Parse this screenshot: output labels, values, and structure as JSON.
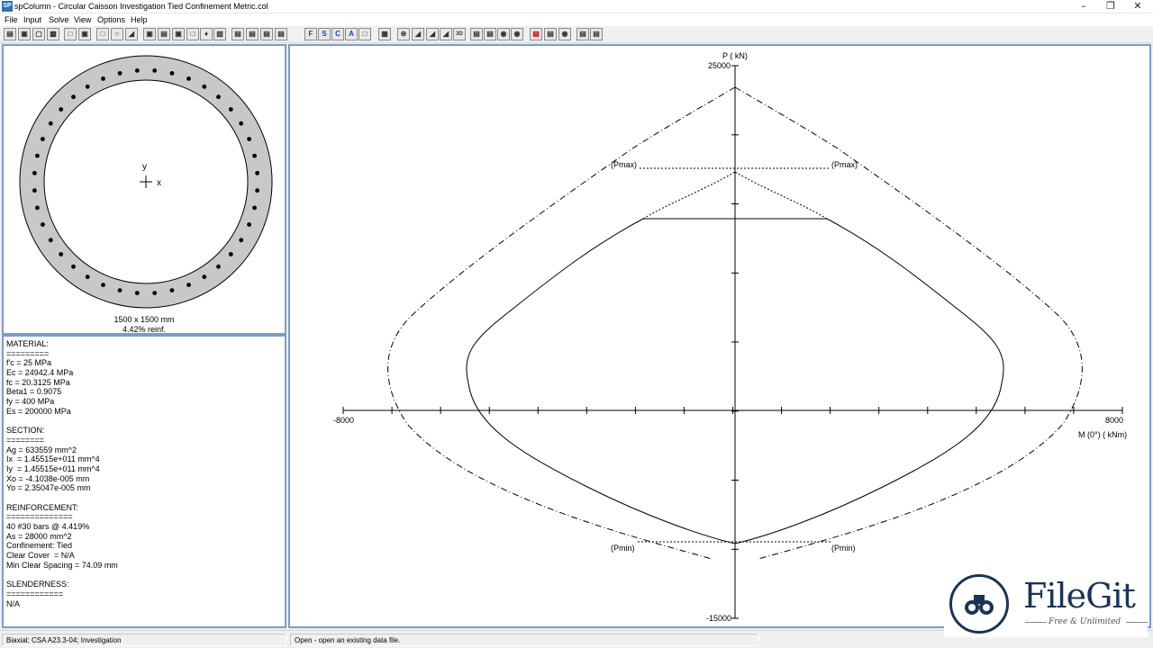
{
  "titlebar": {
    "app_icon": "SP",
    "title": "spColumn - Circular Caisson Investigation Tied Confinement Metric.col",
    "minimize_icon": "minimize-icon",
    "maximize_icon": "restore-icon",
    "close_icon": "close-icon"
  },
  "menu": [
    "File",
    "Input",
    "Solve",
    "View",
    "Options",
    "Help"
  ],
  "toolbar": {
    "text_buttons": [
      "F",
      "S",
      "C",
      "A",
      "3D"
    ]
  },
  "section": {
    "dimensions": "1500 x 1500 mm",
    "reinforcement": "4.42% reinf.",
    "axis_y": "y",
    "axis_x": "x",
    "bar_count": 40
  },
  "properties": [
    "MATERIAL:",
    "=========",
    "f'c = 25 MPa",
    "Ec = 24942.4 MPa",
    "fc = 20.3125 MPa",
    "Beta1 = 0.9075",
    "fy = 400 MPa",
    "Es = 200000 MPa",
    "",
    "SECTION:",
    "========",
    "Ag = 633559 mm^2",
    "Ix  = 1.45515e+011 mm^4",
    "Iy  = 1.45515e+011 mm^4",
    "Xo = -4.1038e-005 mm",
    "Yo = 2.35047e-005 mm",
    "",
    "REINFORCEMENT:",
    "==============",
    "40 #30 bars @ 4.419%",
    "As = 28000 mm^2",
    "Confinement: Tied",
    "Clear Cover  = N/A",
    "Min Clear Spacing = 74.09 mm",
    "",
    "SLENDERNESS:",
    "============",
    "N/A"
  ],
  "diagram": {
    "y_axis_label": "P ( kN)",
    "x_axis_label": "M (0°) ( kNm)",
    "x_min_label": "-8000",
    "x_max_label": "8000",
    "y_max_label": "25000",
    "y_min_label": "-15000",
    "pmax_left": "(Pmax)",
    "pmax_right": "(Pmax)",
    "pmin_left": "(Pmin)",
    "pmin_right": "(Pmin)"
  },
  "status": {
    "left": "Biaxial; CSA A23.3-04; Investigation",
    "right": "Open - open an existing data file."
  },
  "watermark": {
    "name": "FileGit",
    "tagline": "Free & Unlimited"
  },
  "colors": {
    "panel_border": "#7b9cc8",
    "concrete": "#c8c8c8",
    "bar": "#000000",
    "watermark_navy": "#1b3553"
  }
}
